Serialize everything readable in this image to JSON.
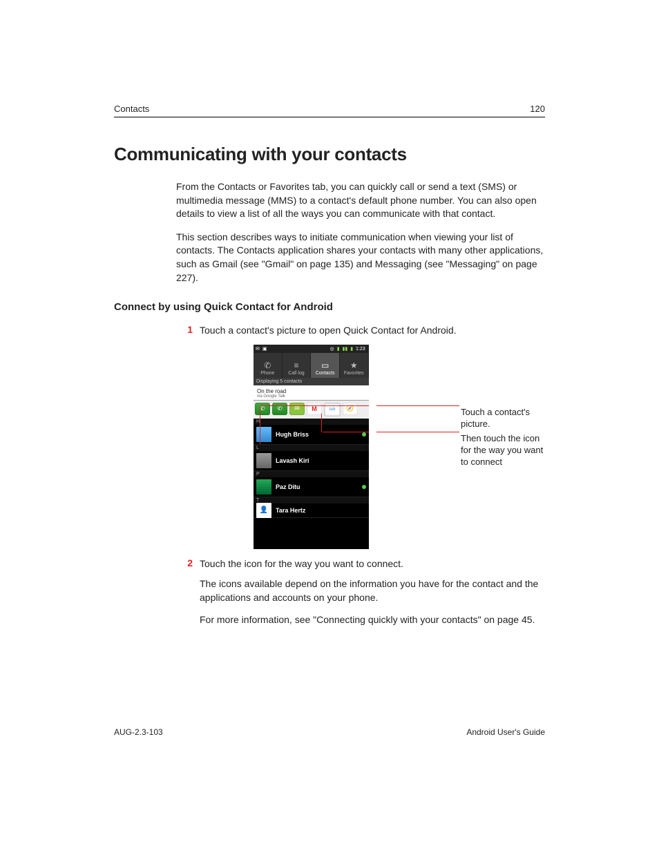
{
  "header": {
    "section": "Contacts",
    "page_number": "120"
  },
  "title": "Communicating with your contacts",
  "intro": {
    "p1": "From the Contacts or Favorites tab, you can quickly call or send a text (SMS) or multimedia message (MMS) to a contact's default phone number. You can also open details to view a list of all the ways you can communicate with that contact.",
    "p2": "This section describes ways to initiate communication when viewing your list of contacts. The Contacts application shares your contacts with many other applications, such as Gmail (see \"Gmail\" on page 135) and Messaging (see \"Messaging\" on page 227)."
  },
  "subheading": "Connect by using Quick Contact for Android",
  "steps": {
    "n1": "1",
    "s1": "Touch a contact's picture to open Quick Contact for Android.",
    "n2": "2",
    "s2": "Touch the icon for the way you want to connect.",
    "s2a": "The icons available depend on the information you have for the contact and the applications and accounts on your phone.",
    "s2b": "For more information, see \"Connecting quickly with your contacts\" on page 45."
  },
  "callouts": {
    "c1": "Touch a contact's picture.",
    "c2": "Then touch the icon for the way you want to connect"
  },
  "phone": {
    "clock": "1:23",
    "tabs": {
      "phone": "Phone",
      "calllog": "Call log",
      "contacts": "Contacts",
      "favorites": "Favorites"
    },
    "display_bar": "Displaying 5 contacts",
    "status_text": "On the road",
    "status_sub": "via Google Talk",
    "qc": {
      "talk": "talk"
    },
    "letters": {
      "h": "H",
      "l": "L",
      "p": "P",
      "t": "T"
    },
    "contacts": {
      "c1": "Hugh Briss",
      "c2": "Lavash Kiri",
      "c3": "Paz Ditu",
      "c4": "Tara Hertz"
    }
  },
  "footer": {
    "left": "AUG-2.3-103",
    "right": "Android User's Guide"
  }
}
